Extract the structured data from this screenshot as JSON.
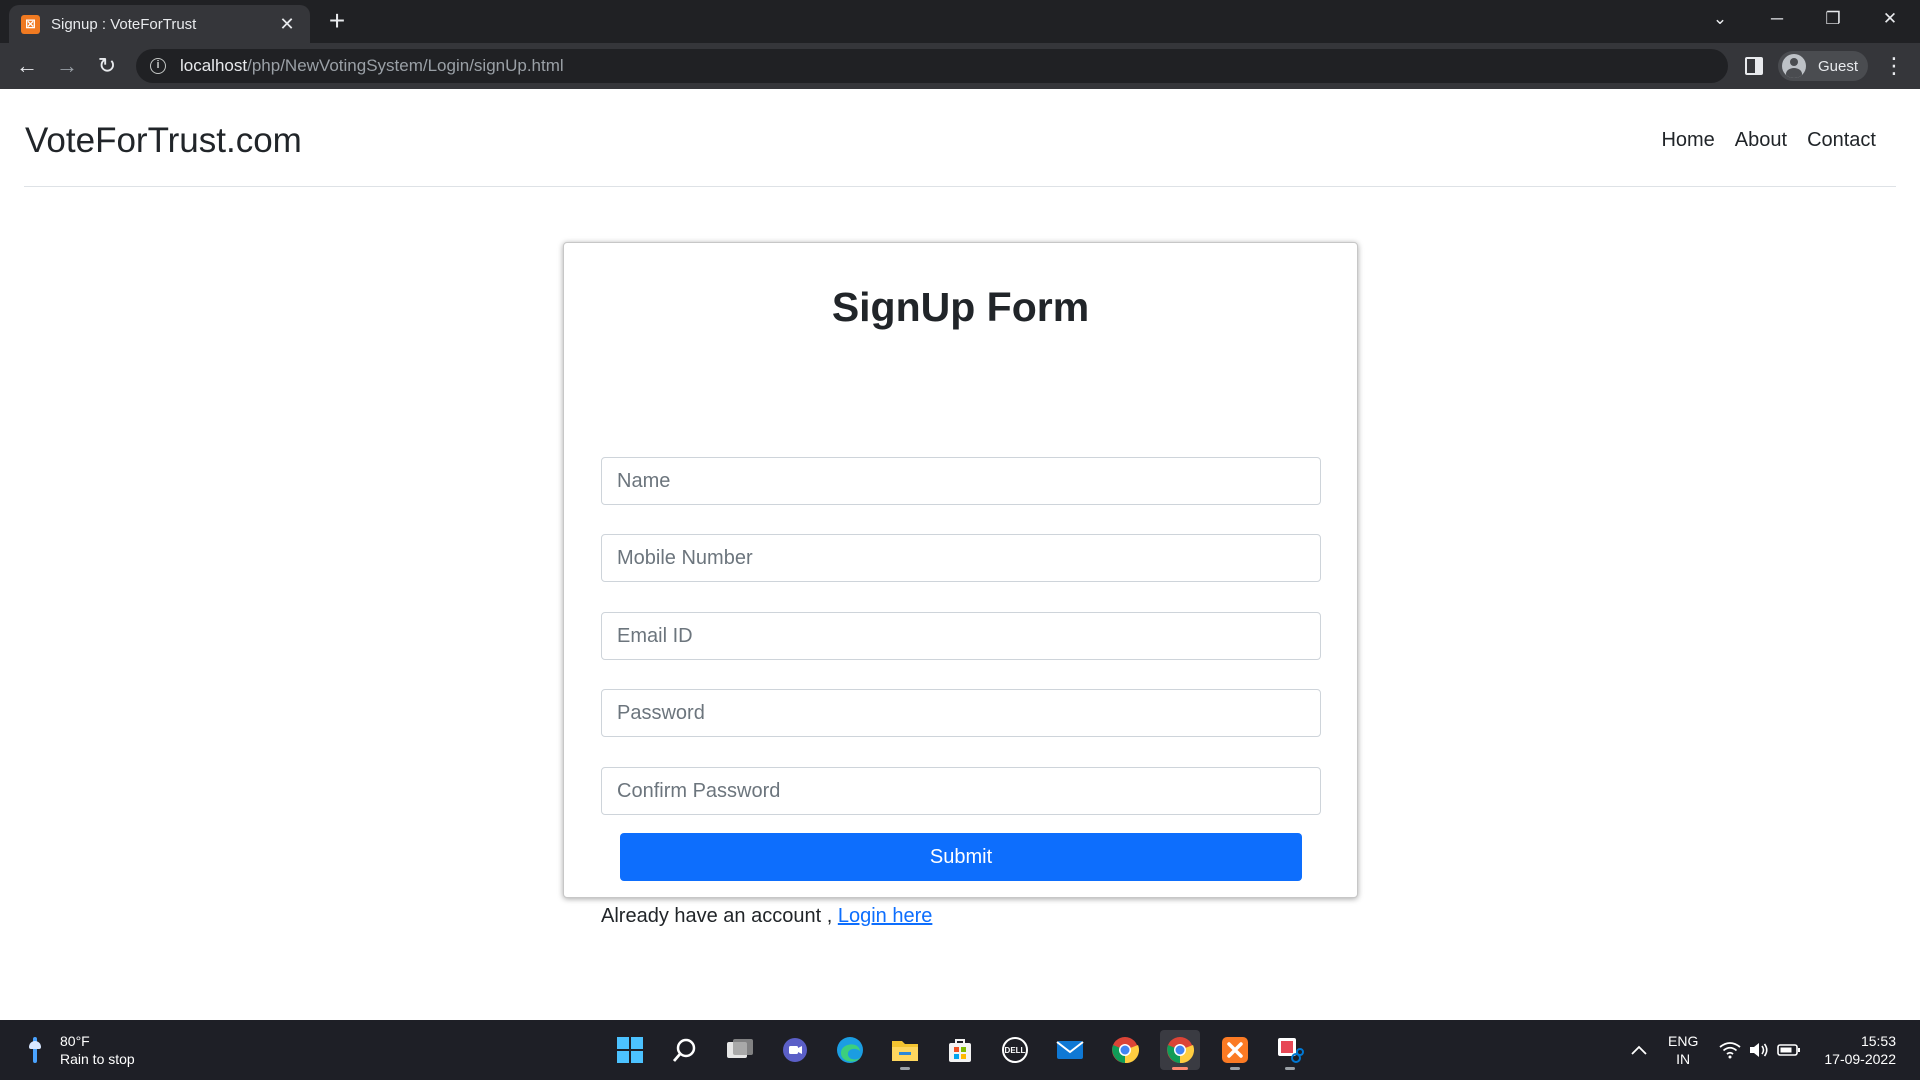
{
  "browser": {
    "tab_title": "Signup : VoteForTrust",
    "tab_favicon": "xampp-icon",
    "url_host": "localhost",
    "url_path": "/php/NewVotingSystem/Login/signUp.html",
    "profile_label": "Guest"
  },
  "navbar": {
    "brand": "VoteForTrust.com",
    "links": [
      "Home",
      "About",
      "Contact"
    ]
  },
  "form": {
    "title": "SignUp Form",
    "fields": {
      "name": "Name",
      "mobile": "Mobile Number",
      "email": "Email ID",
      "password": "Password",
      "confirm": "Confirm Password"
    },
    "submit_label": "Submit",
    "login_prompt": "Already have an account ,",
    "login_link": "Login here"
  },
  "taskbar": {
    "weather_temp": "80°F",
    "weather_desc": "Rain to stop",
    "lang_1": "ENG",
    "lang_2": "IN",
    "time": "15:53",
    "date": "17-09-2022"
  },
  "colors": {
    "primary": "#0d6efd",
    "link": "#0d6efd",
    "chrome_dark": "#202124"
  }
}
